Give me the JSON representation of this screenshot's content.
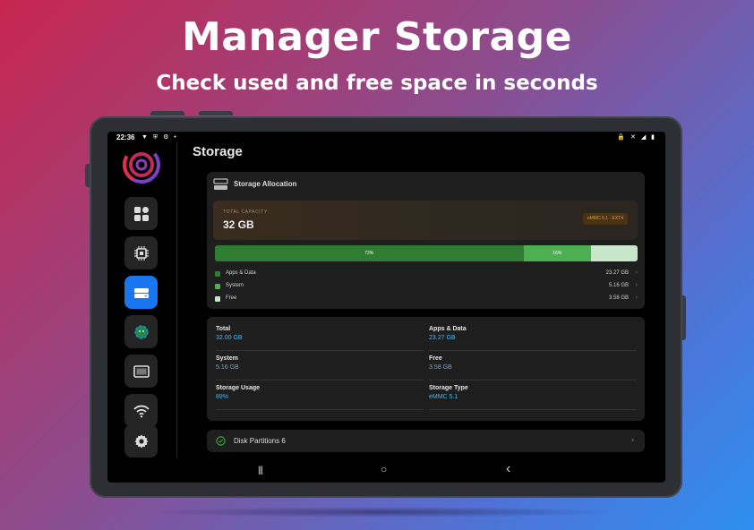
{
  "promo": {
    "headline": "Manager Storage",
    "subheadline": "Check used and free space in seconds"
  },
  "status_bar": {
    "time": "22:36",
    "left_icons": [
      "notification-icon",
      "shield-icon",
      "settings-icon",
      "dot-icon"
    ],
    "right_icons": [
      "lock-icon",
      "mute-icon",
      "signal-icon",
      "battery-icon"
    ]
  },
  "rail": {
    "items": [
      {
        "name": "dashboard",
        "icon": "dashboard-icon",
        "active": false
      },
      {
        "name": "cpu",
        "icon": "chip-icon",
        "active": false
      },
      {
        "name": "storage",
        "icon": "drive-icon",
        "active": true
      },
      {
        "name": "android",
        "icon": "android-icon",
        "active": false
      },
      {
        "name": "display",
        "icon": "display-icon",
        "active": false
      },
      {
        "name": "network",
        "icon": "wifi-icon",
        "active": false
      },
      {
        "name": "settings",
        "icon": "gear-icon",
        "active": false
      }
    ]
  },
  "page": {
    "title": "Storage"
  },
  "allocation": {
    "title": "Storage Allocation",
    "capacity_label": "TOTAL CAPACITY",
    "capacity_value": "32 GB",
    "badge": "eMMC 5.1 · EXT4",
    "segments": [
      {
        "label": "73%",
        "fraction": 0.73,
        "color": "#2e7d32"
      },
      {
        "label": "16%",
        "fraction": 0.16,
        "color": "#4caf50"
      },
      {
        "label": "",
        "fraction": 0.11,
        "color": "#c8e6c9"
      }
    ],
    "legend": [
      {
        "name": "Apps & Data",
        "size": "23.27 GB",
        "color": "#2e7d32"
      },
      {
        "name": "System",
        "size": "5.16 GB",
        "color": "#4caf50"
      },
      {
        "name": "Free",
        "size": "3.58 GB",
        "color": "#c8e6c9"
      }
    ]
  },
  "stats": {
    "total_label": "Total",
    "total_value": "32.00 GB",
    "apps_label": "Apps & Data",
    "apps_value": "23.27 GB",
    "system_label": "System",
    "system_value": "5.16 GB",
    "free_label": "Free",
    "free_value": "3.58 GB",
    "usage_label": "Storage Usage",
    "usage_value": "89%",
    "type_label": "Storage Type",
    "type_value": "eMMC 5.1"
  },
  "partitions": {
    "label": "Disk Partitions 6"
  },
  "navbar": {
    "recents": "|||",
    "home": "○",
    "back": "‹"
  },
  "colors": {
    "accent": "#1976f0",
    "value_blue": "#4fb3ea",
    "badge_orange": "#e89a32"
  }
}
